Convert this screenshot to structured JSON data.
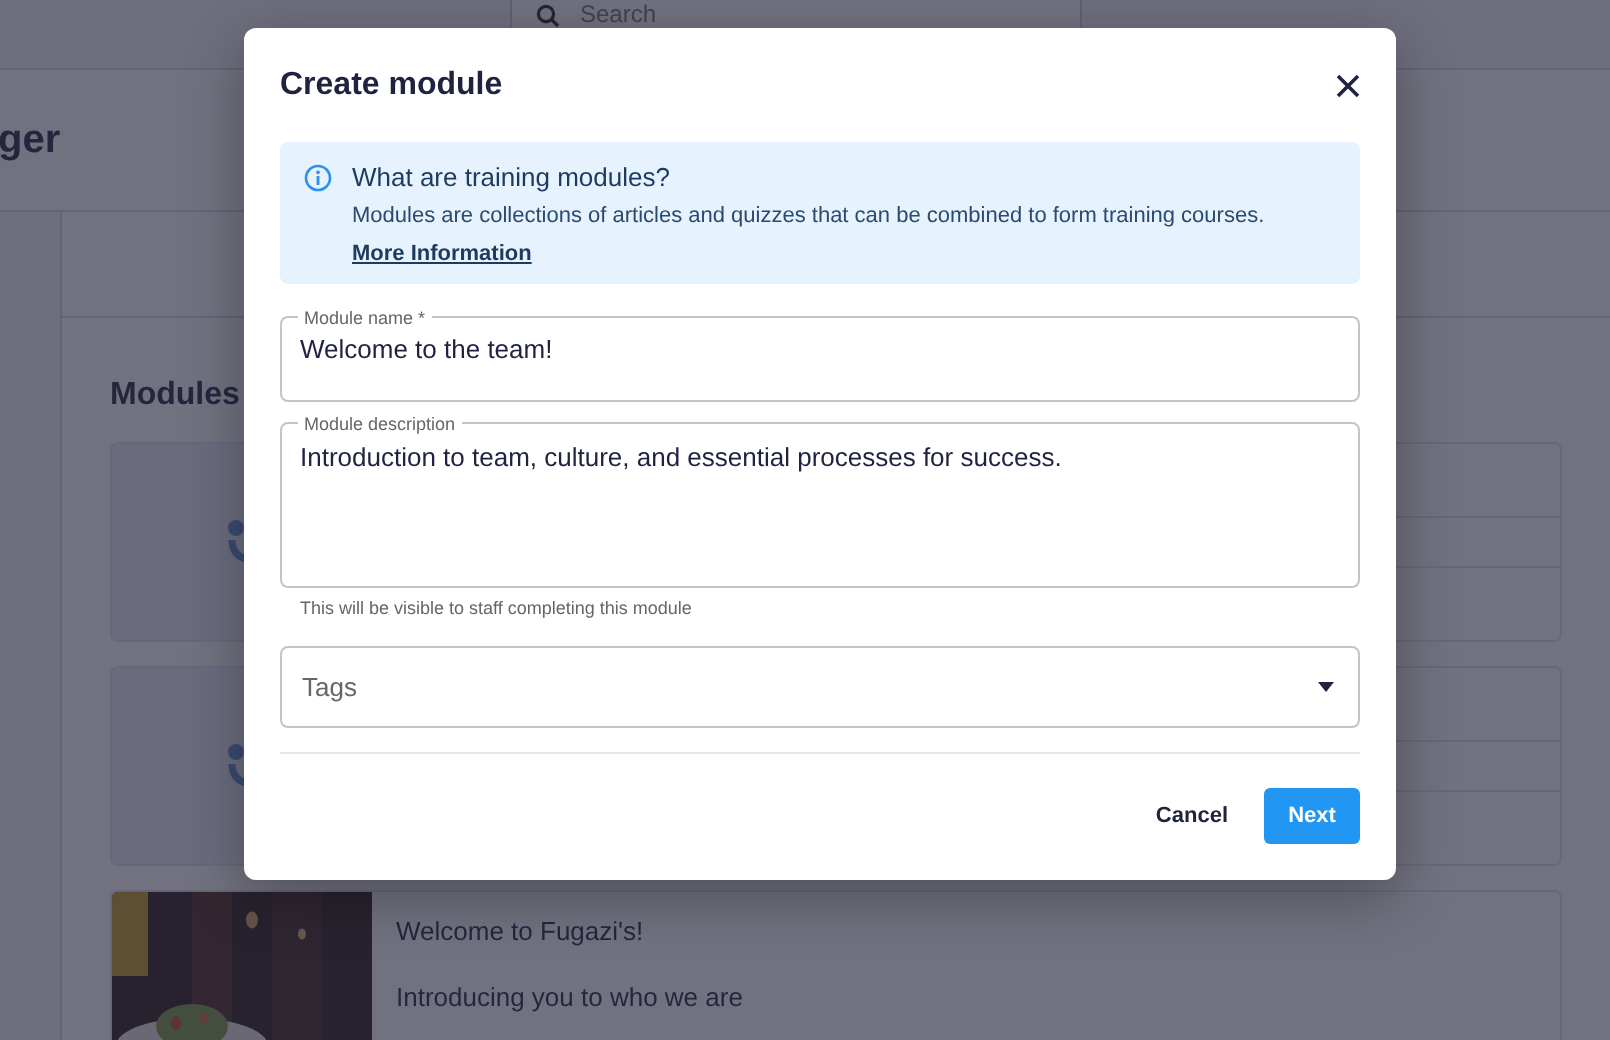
{
  "background": {
    "search": {
      "placeholder": "Search"
    },
    "page_title": "ger",
    "section_title": "Modules",
    "modules": [
      {
        "kind": "placeholder"
      },
      {
        "kind": "placeholder"
      },
      {
        "kind": "picture",
        "title": "Welcome to Fugazi's!",
        "description": "Introducing you to who we are"
      }
    ]
  },
  "modal": {
    "title": "Create module",
    "info": {
      "title": "What are training modules?",
      "body": "Modules are collections of articles and quizzes that can be combined to form training courses.",
      "link": "More Information"
    },
    "name_field": {
      "label": "Module name *",
      "value": "Welcome to the team!"
    },
    "description_field": {
      "label": "Module description",
      "value": "Introduction to team, culture, and essential processes for success.",
      "helper": "This will be visible to staff completing this module"
    },
    "tags_field": {
      "placeholder": "Tags"
    },
    "buttons": {
      "cancel": "Cancel",
      "next": "Next"
    }
  }
}
